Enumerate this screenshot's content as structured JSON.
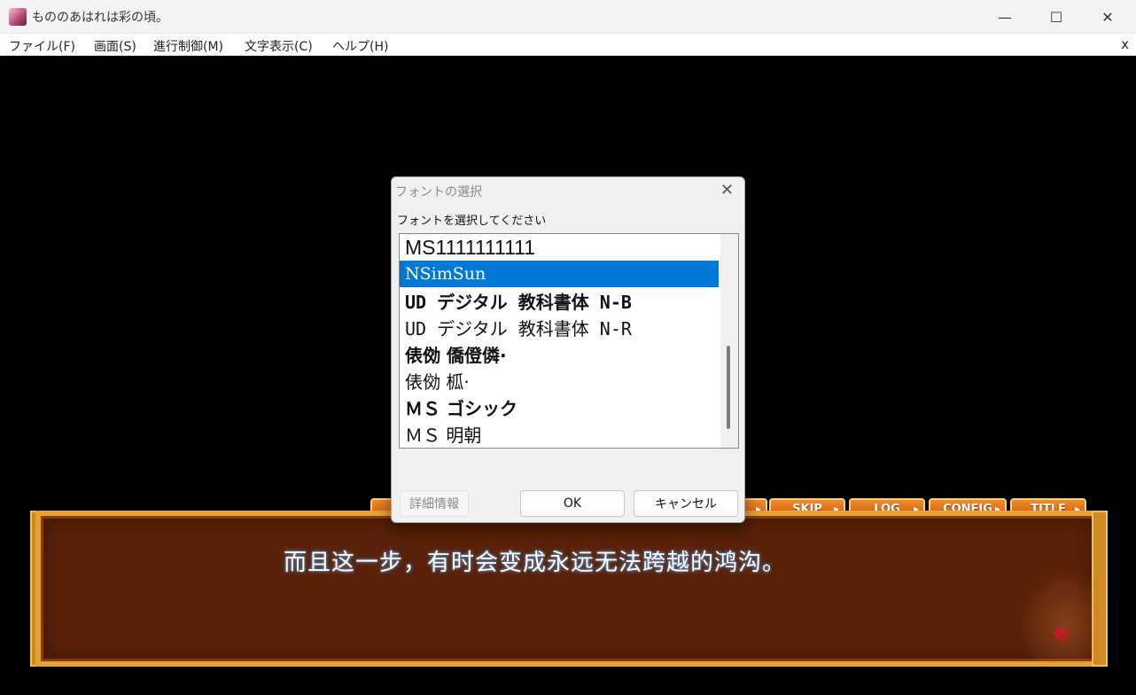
{
  "window": {
    "title": "もののあはれは彩の頃。",
    "icon": "app-character-icon",
    "controls": {
      "minimize": "—",
      "maximize": "☐",
      "close": "✕"
    }
  },
  "menu": {
    "items": [
      "ファイル(F)",
      "画面(S)",
      "進行制御(M)",
      "文字表示(C)",
      "ヘルプ(H)"
    ],
    "close": "x"
  },
  "dialog": {
    "title": "フォントの選択",
    "close": "✕",
    "prompt": "フォントを選択してください",
    "fonts": [
      "MS1111111111",
      "NSimSun",
      "UD デジタル 教科書体 N-B",
      "UD デジタル 教科書体 N-R",
      "俵俲 僑僜僯·",
      "俵俲 柧·",
      "ＭＳ ゴシック",
      "ＭＳ 明朝"
    ],
    "selected_index": 1,
    "buttons": {
      "details": "詳細情報",
      "ok": "OK",
      "cancel": "キャンセル"
    }
  },
  "game": {
    "dialogue": "而且这一步，有时会变成永远无法跨越的鸿沟。",
    "buttons": {
      "skip": "SKIP",
      "log": "LOG",
      "config": "CONFIG",
      "title": "TITLE"
    },
    "accent_color": "#e3a234",
    "box_color": "#5a2208"
  }
}
